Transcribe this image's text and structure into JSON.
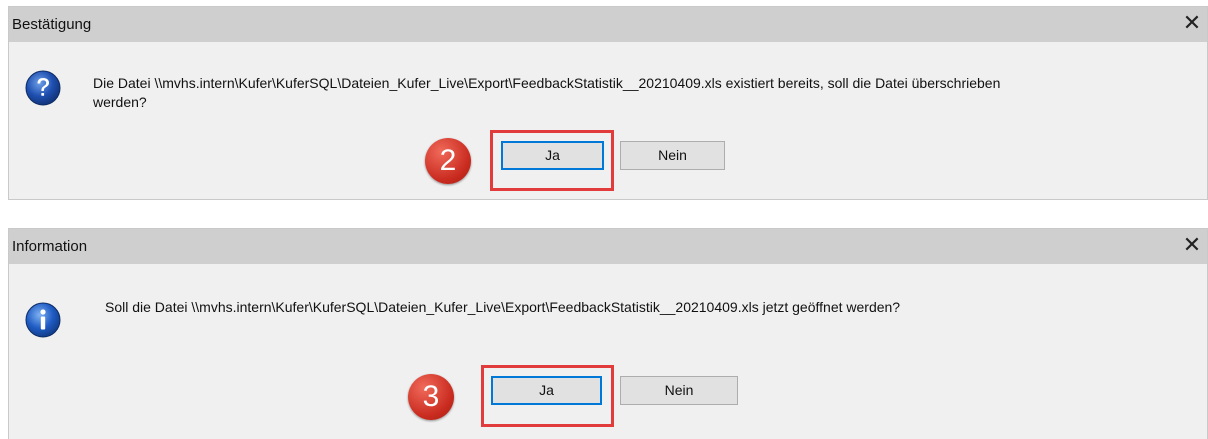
{
  "dialogs": [
    {
      "title": "Bestätigung",
      "icon": "question-icon",
      "message_line1": "Die Datei \\\\mvhs.intern\\Kufer\\KuferSQL\\Dateien_Kufer_Live\\Export\\FeedbackStatistik__20210409.xls existiert bereits, soll die Datei überschrieben",
      "message_line2": "werden?",
      "yes_label": "Ja",
      "no_label": "Nein",
      "step_badge": "2"
    },
    {
      "title": "Information",
      "icon": "info-icon",
      "message": "Soll die Datei \\\\mvhs.intern\\Kufer\\KuferSQL\\Dateien_Kufer_Live\\Export\\FeedbackStatistik__20210409.xls jetzt geöffnet werden?",
      "yes_label": "Ja",
      "no_label": "Nein",
      "step_badge": "3"
    }
  ],
  "colors": {
    "titlebar": "#cfcfcf",
    "body": "#f0f0f0",
    "highlight": "#e23b3b",
    "default_button_border": "#0078d7"
  }
}
